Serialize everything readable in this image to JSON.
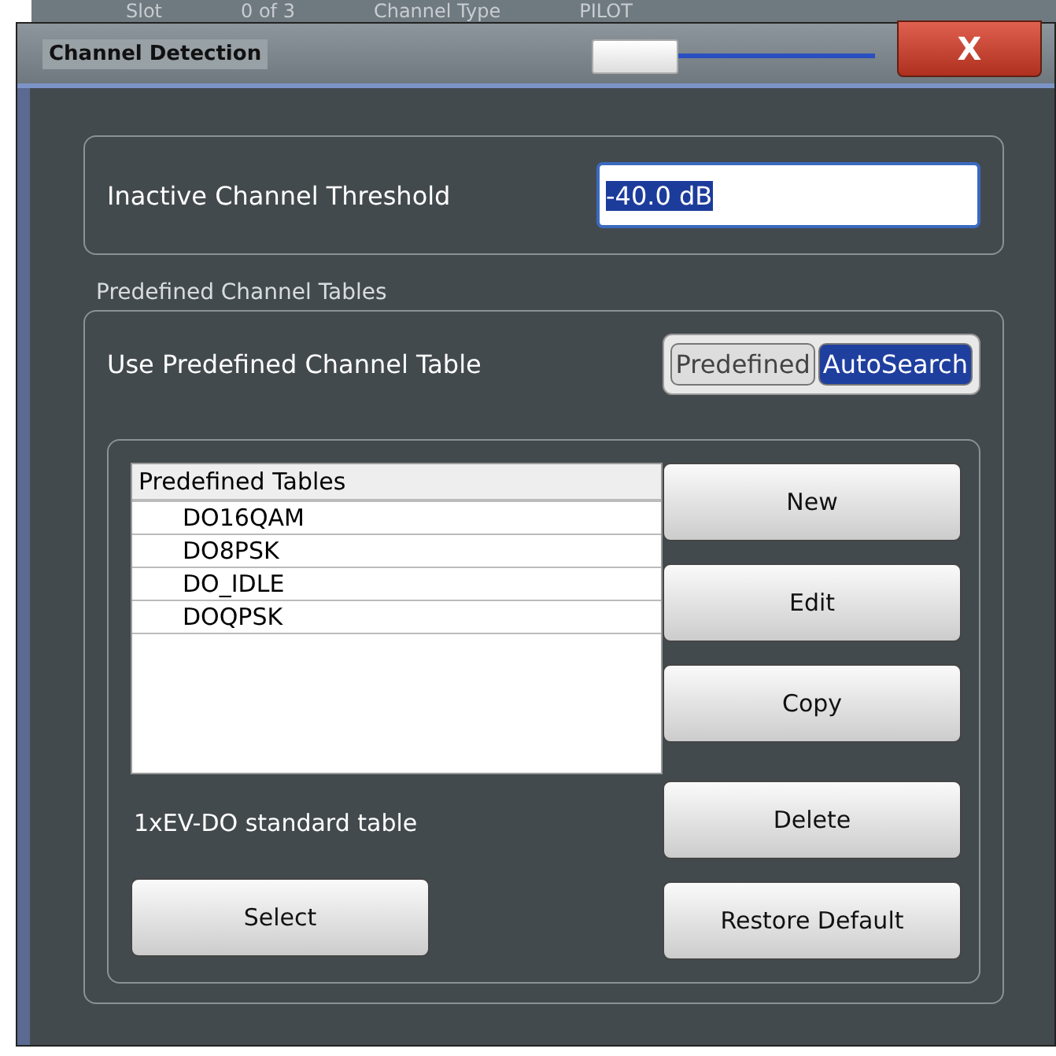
{
  "background_labels": [
    "Slot",
    "0 of 3",
    "Channel Type",
    "PILOT"
  ],
  "window": {
    "title": "Channel Detection",
    "close": "X",
    "transparency_slider": {
      "level": 0
    }
  },
  "threshold": {
    "label": "Inactive Channel Threshold",
    "value": "-40.0 dB"
  },
  "predefined": {
    "group_title": "Predefined Channel Tables",
    "toggle_label": "Use Predefined Channel Table",
    "toggle_options": [
      {
        "label": "Predefined",
        "selected": false
      },
      {
        "label": "AutoSearch",
        "selected": true
      }
    ],
    "table": {
      "header": "Predefined Tables",
      "rows": [
        "DO16QAM",
        "DO8PSK",
        "DO_IDLE",
        "DOQPSK"
      ]
    },
    "buttons": [
      "New",
      "Edit",
      "Copy",
      "Delete",
      "Restore Default"
    ],
    "info": "1xEV-DO standard table",
    "select_button": "Select"
  }
}
